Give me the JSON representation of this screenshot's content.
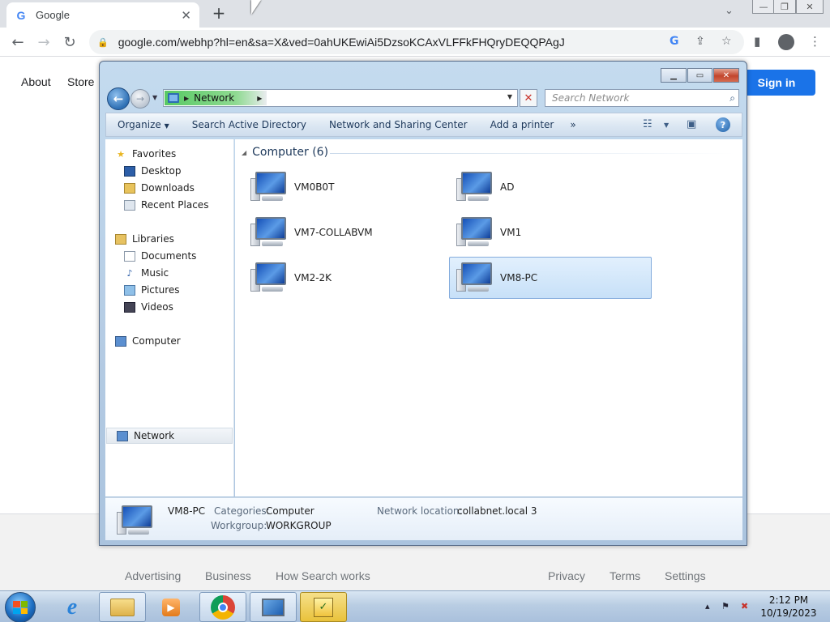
{
  "browser": {
    "tab_title": "Google",
    "url": "google.com/webhp?hl=en&sa=X&ved=0ahUKEwiAi5DzsoKCAxVLFFkFHQryDEQQPAgJ"
  },
  "google": {
    "header_links": [
      "About",
      "Store"
    ],
    "sign_in": "Sign in",
    "footer_left": [
      "Advertising",
      "Business",
      "How Search works"
    ],
    "footer_right": [
      "Privacy",
      "Terms",
      "Settings"
    ]
  },
  "explorer": {
    "breadcrumb": "Network",
    "search_placeholder": "Search Network",
    "commands": [
      "Organize",
      "Search Active Directory",
      "Network and Sharing Center",
      "Add a printer"
    ],
    "more_symbol": "»",
    "nav": {
      "favorites": "Favorites",
      "favorite_items": [
        "Desktop",
        "Downloads",
        "Recent Places"
      ],
      "libraries": "Libraries",
      "library_items": [
        "Documents",
        "Music",
        "Pictures",
        "Videos"
      ],
      "computer": "Computer",
      "network": "Network"
    },
    "group_header": "Computer (6)",
    "computers": [
      "VM0B0T",
      "AD",
      "VM7-COLLABVM",
      "VM1",
      "VM2-2K",
      "VM8-PC"
    ],
    "selected_computer": "VM8-PC",
    "details": {
      "name": "VM8-PC",
      "categories_label": "Categories:",
      "categories_value": "Computer",
      "workgroup_label": "Workgroup:",
      "workgroup_value": "WORKGROUP",
      "network_location_label": "Network location:",
      "network_location_value": "collabnet.local 3"
    }
  },
  "taskbar": {
    "time": "2:12 PM",
    "date": "10/19/2023"
  },
  "colors": {
    "selection_bg": "#c7e0f8",
    "sign_in_blue": "#1a73e8",
    "taskbar_active": "#e9c23b"
  }
}
